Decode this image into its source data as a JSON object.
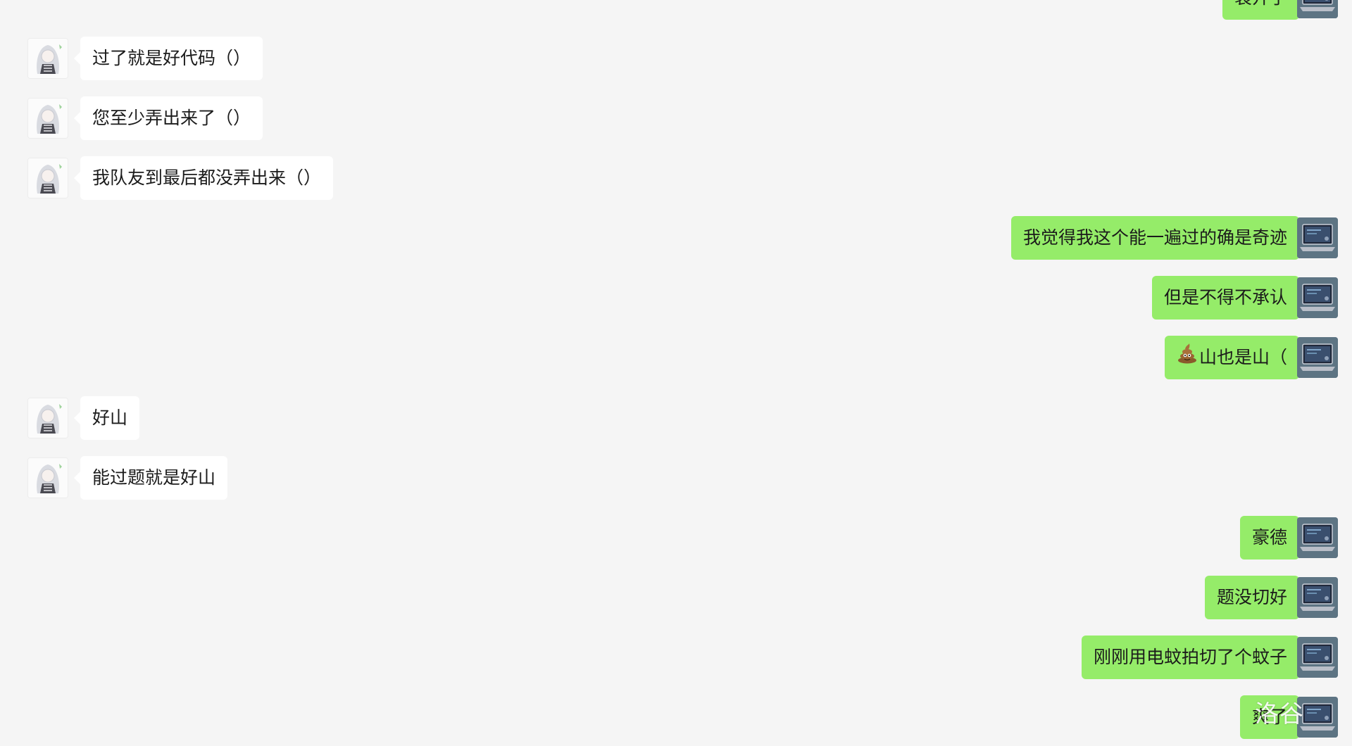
{
  "messages": [
    {
      "side": "right",
      "text": "裂开了"
    },
    {
      "side": "left",
      "text": "过了就是好代码（）"
    },
    {
      "side": "left",
      "text": "您至少弄出来了（）"
    },
    {
      "side": "left",
      "text": "我队友到最后都没弄出来（）"
    },
    {
      "side": "right",
      "text": "我觉得我这个能一遍过的确是奇迹"
    },
    {
      "side": "right",
      "text": "但是不得不承认"
    },
    {
      "side": "right",
      "text": "山也是山（",
      "emoji": "poop-emoji"
    },
    {
      "side": "left",
      "text": "好山"
    },
    {
      "side": "left",
      "text": "能过题就是好山"
    },
    {
      "side": "right",
      "text": "豪德"
    },
    {
      "side": "right",
      "text": "题没切好"
    },
    {
      "side": "right",
      "text": "刚刚用电蚊拍切了个蚊子"
    },
    {
      "side": "right",
      "text": "爽了"
    }
  ],
  "watermark": "洛谷",
  "colors": {
    "background": "#f5f5f5",
    "incoming_bubble": "#ffffff",
    "outgoing_bubble": "#95ec69",
    "text": "#1b1b1b"
  }
}
